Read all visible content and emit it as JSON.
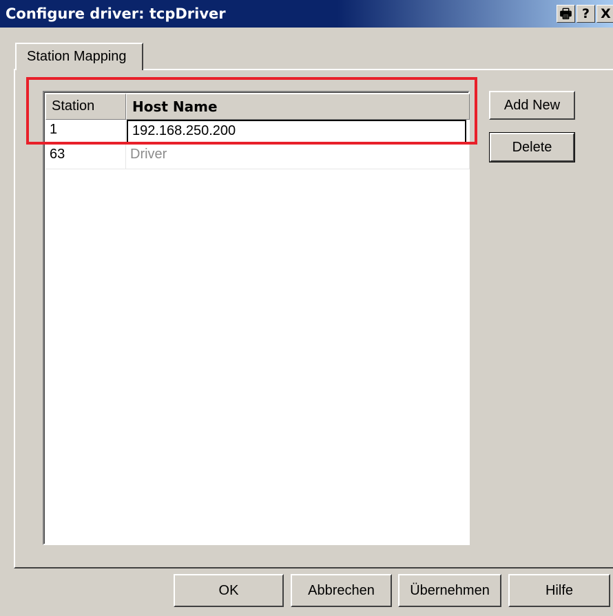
{
  "window": {
    "title": "Configure driver: tcpDriver",
    "buttons": [
      {
        "label": "🖶",
        "icon": "print-icon"
      },
      {
        "label": "?",
        "icon": "help-icon"
      },
      {
        "label": "X",
        "icon": "close-icon"
      }
    ]
  },
  "tabs": [
    {
      "label": "Station Mapping",
      "selected": true
    }
  ],
  "table": {
    "columns": [
      "Station",
      "Host Name"
    ],
    "rows": [
      {
        "station": "1",
        "host": "192.168.250.200",
        "editing": true
      },
      {
        "station": "63",
        "host": "Driver",
        "editing": false
      }
    ]
  },
  "side_buttons": {
    "add_new": "Add New",
    "delete": "Delete"
  },
  "footer_buttons": {
    "ok": "OK",
    "cancel": "Abbrechen",
    "apply": "Übernehmen",
    "help": "Hilfe"
  },
  "colors": {
    "titlebar": "#0a246a",
    "highlight": "#e8202a",
    "dialog_bg": "#d4d0c8"
  }
}
